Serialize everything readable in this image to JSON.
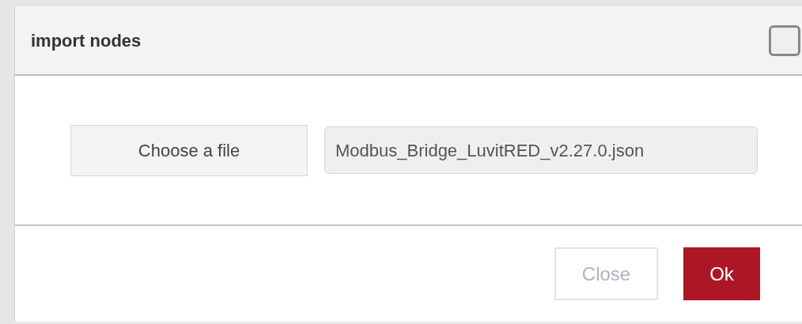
{
  "dialog": {
    "title": "import nodes",
    "header_checkbox": {
      "checked": false
    },
    "choose_button": "Choose a file",
    "file_field": {
      "value": "Modbus_Bridge_LuvitRED_v2.27.0.json"
    },
    "buttons": [
      {
        "label": "Close",
        "kind": "secondary",
        "disabled": true
      },
      {
        "label": "Ok",
        "kind": "primary",
        "disabled": false
      }
    ]
  }
}
